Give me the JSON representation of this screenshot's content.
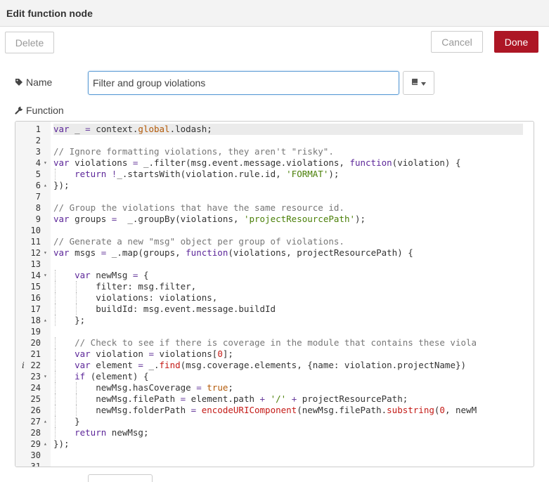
{
  "dialog": {
    "title": "Edit function node"
  },
  "toolbar": {
    "delete_label": "Delete",
    "cancel_label": "Cancel",
    "done_label": "Done"
  },
  "form": {
    "name_label": "Name",
    "name_value": "Filter and group violations",
    "function_label": "Function"
  },
  "icons": {
    "name": "tag-icon",
    "function": "wrench-icon",
    "book": "book-icon",
    "caret": "caret-down-icon"
  },
  "colors": {
    "done_button": "#ad1625",
    "input_focus_border": "#5b9bd5"
  },
  "editor": {
    "active_line": 1,
    "lines": [
      "var _ = context.global.lodash;",
      "",
      "// Ignore formatting violations, they aren't \"risky\".",
      "var violations = _.filter(msg.event.message.violations, function(violation) {",
      "    return !_.startsWith(violation.rule.id, 'FORMAT');",
      "});",
      "",
      "// Group the violations that have the same resource id.",
      "var groups =  _.groupBy(violations, 'projectResourcePath');",
      "",
      "// Generate a new \"msg\" object per group of violations.",
      "var msgs = _.map(groups, function(violations, projectResourcePath) {",
      "",
      "    var newMsg = {",
      "        filter: msg.filter,",
      "        violations: violations,",
      "        buildId: msg.event.message.buildId",
      "    };",
      "",
      "    // Check to see if there is coverage in the module that contains these viola",
      "    var violation = violations[0];",
      "    var element = _.find(msg.coverage.elements, {name: violation.projectName})",
      "    if (element) {",
      "        newMsg.hasCoverage = true;",
      "        newMsg.filePath = element.path + '/' + projectResourcePath;",
      "        newMsg.folderPath = encodeURIComponent(newMsg.filePath.substring(0, newM",
      "    }",
      "    return newMsg;",
      "});",
      "",
      ""
    ],
    "line_numbers": [
      "1",
      "2",
      "3",
      "4",
      "5",
      "6",
      "7",
      "8",
      "9",
      "10",
      "11",
      "12",
      "13",
      "14",
      "15",
      "16",
      "17",
      "18",
      "19",
      "20",
      "21",
      "22",
      "23",
      "24",
      "25",
      "26",
      "27",
      "28",
      "29",
      "30",
      "31"
    ],
    "fold_open_lines": [
      4,
      12,
      14,
      23
    ],
    "fold_close_lines": [
      6,
      18,
      27,
      29
    ],
    "info_marker_lines": [
      22
    ],
    "info_marker_symbol": "i"
  }
}
